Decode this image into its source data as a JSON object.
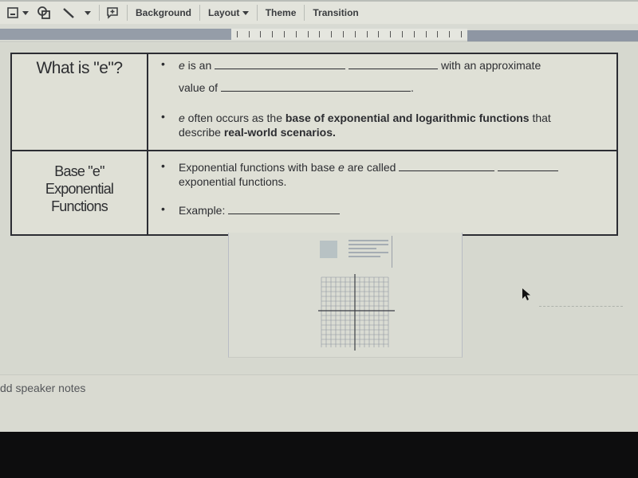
{
  "toolbar": {
    "icons": [
      "image-insert-icon",
      "dropdown-arrow-icon",
      "shape-icon",
      "line-icon",
      "dropdown-arrow-icon",
      "add-comment-icon"
    ],
    "buttons": {
      "background": "Background",
      "layout": "Layout",
      "theme": "Theme",
      "transition": "Transition"
    }
  },
  "slide": {
    "table": {
      "rows": [
        {
          "label": "What is \"e\"?",
          "bullet1": {
            "prefix_italic": "e",
            "prefix": " is an",
            "suffix": "with an approximate",
            "line2_prefix": "value of",
            "line2_suffix": "."
          },
          "bullet2": {
            "prefix_italic": "e",
            "text1": " often occurs as the ",
            "bold1": "base of exponential and logarithmic functions",
            "text2": " that",
            "text3": "describe ",
            "bold2": "real-world scenarios."
          }
        },
        {
          "label_line1": "Base \"e\"",
          "label_line2": "Exponential",
          "label_line3": "Functions",
          "bullet1": {
            "text1": "Exponential functions with base ",
            "italic": "e",
            "text2": " are called",
            "line2": "exponential functions."
          },
          "bullet2": {
            "label": "Example:"
          }
        }
      ]
    }
  },
  "notes": {
    "placeholder": "dd speaker notes"
  },
  "colors": {
    "background": "#d9dbd3",
    "border": "#2c2d33",
    "ruler_shade": "#8e96a3",
    "bezel": "#0d0d0e"
  }
}
